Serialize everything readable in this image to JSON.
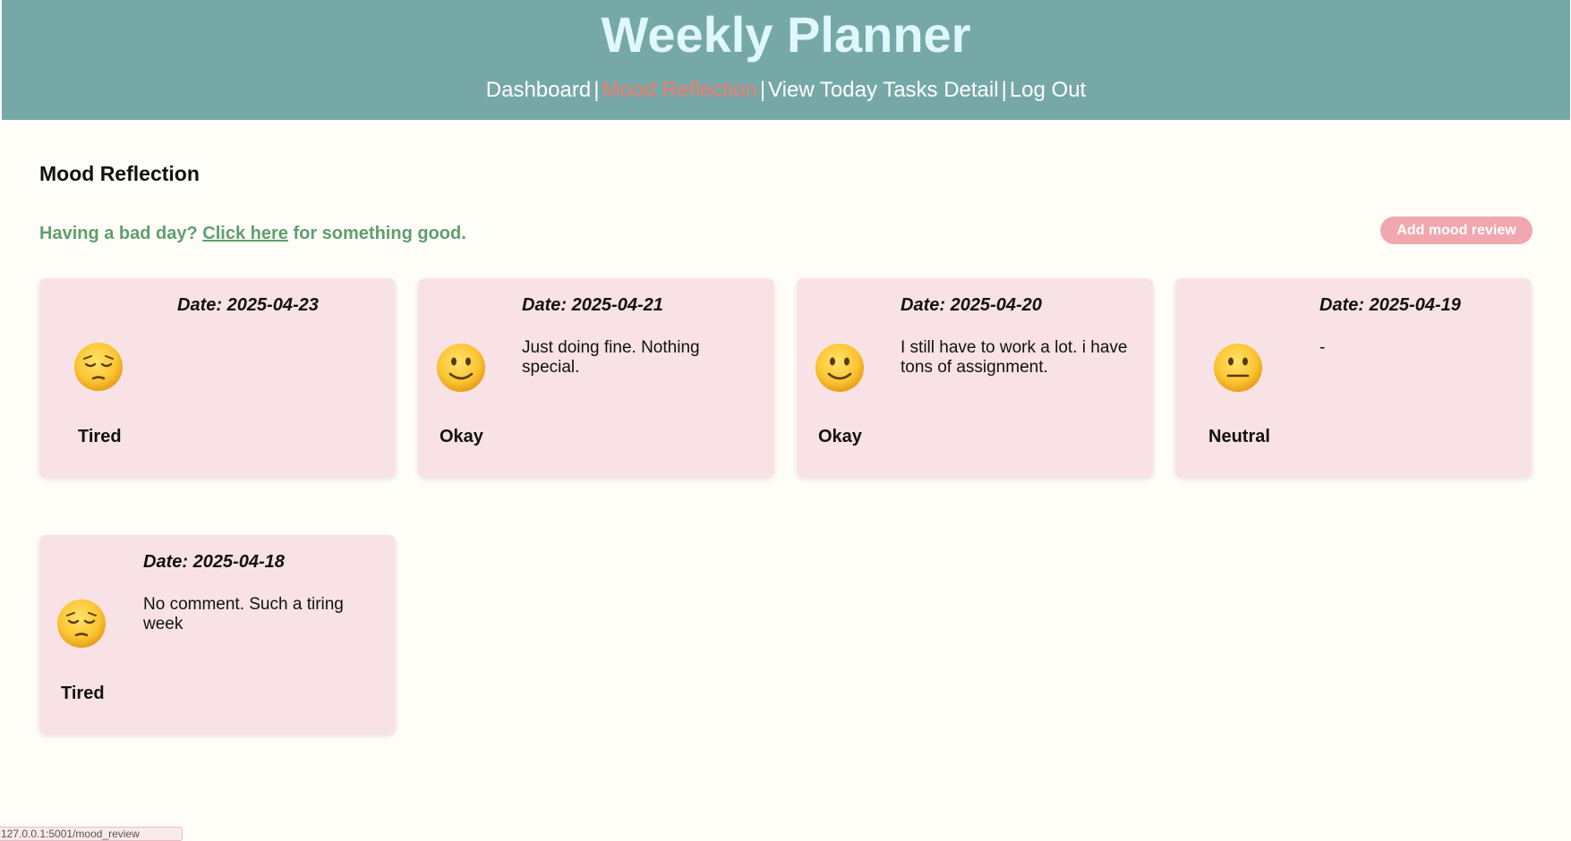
{
  "header": {
    "title": "Weekly Planner",
    "nav": [
      {
        "label": "Dashboard",
        "active": false
      },
      {
        "label": "Mood Reflection",
        "active": true
      },
      {
        "label": "View Today Tasks Detail",
        "active": false
      },
      {
        "label": "Log Out",
        "active": false
      }
    ],
    "separator": "|"
  },
  "page": {
    "heading": "Mood Reflection",
    "bad_day_prefix": "Having a bad day?",
    "bad_day_link": "Click here",
    "bad_day_suffix": "for something good.",
    "add_button_label": "Add mood review"
  },
  "entries": [
    {
      "date_text": "Date: 2025-04-23",
      "mood": "Tired",
      "emoji": "pensive-face-icon",
      "note": ""
    },
    {
      "date_text": "Date: 2025-04-21",
      "mood": "Okay",
      "emoji": "slightly-smiling-face-icon",
      "note": "Just doing fine. Nothing special."
    },
    {
      "date_text": "Date: 2025-04-20",
      "mood": "Okay",
      "emoji": "slightly-smiling-face-icon",
      "note": "I still have to work a lot. i have tons of assignment."
    },
    {
      "date_text": "Date: 2025-04-19",
      "mood": "Neutral",
      "emoji": "neutral-face-icon",
      "note": "-"
    },
    {
      "date_text": "Date: 2025-04-18",
      "mood": "Tired",
      "emoji": "pensive-face-icon",
      "note": "No comment. Such a tiring week"
    }
  ],
  "status_bar": {
    "url": "127.0.0.1:5001/mood_review"
  },
  "colors": {
    "header_bg": "#77a8a8",
    "title": "#dff8fb",
    "nav_active": "#f07c6c",
    "card_bg": "#f9e2e5",
    "link_green": "#5f9e6e",
    "button_bg": "#f0a7ae"
  }
}
